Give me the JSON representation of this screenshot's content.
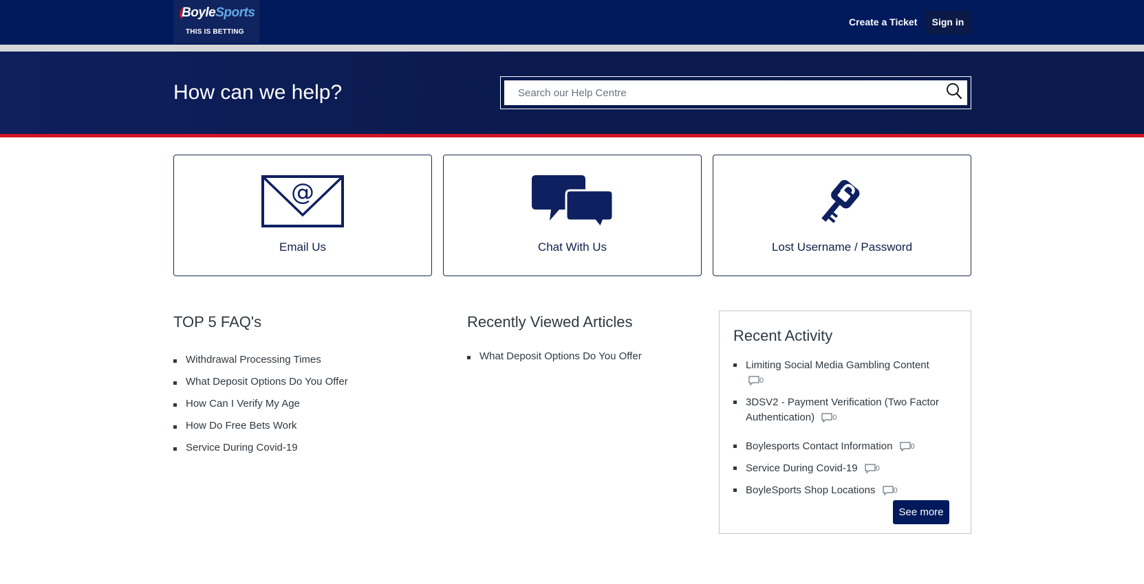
{
  "header": {
    "logo": {
      "word_main": "Boyle",
      "word_accent": "Sports",
      "tagline": "THIS IS BETTING"
    },
    "nav": {
      "create_ticket": "Create a Ticket",
      "sign_in": "Sign in"
    }
  },
  "hero": {
    "title": "How can we help?",
    "search": {
      "placeholder": "Search our Help Centre",
      "value": ""
    }
  },
  "cards": [
    {
      "label": "Email Us",
      "icon": "email-icon"
    },
    {
      "label": "Chat With Us",
      "icon": "chat-icon"
    },
    {
      "label": "Lost Username / Password",
      "icon": "key-lock-icon"
    }
  ],
  "top_faqs": {
    "title": "TOP 5 FAQ's",
    "items": [
      "Withdrawal Processing Times",
      "What Deposit Options Do You Offer",
      "How Can I Verify My Age",
      "How Do Free Bets Work",
      "Service During Covid-19"
    ]
  },
  "recently_viewed": {
    "title": "Recently Viewed Articles",
    "items": [
      "What Deposit Options Do You Offer"
    ]
  },
  "recent_activity": {
    "title": "Recent Activity",
    "items": [
      {
        "line1": "Limiting Social Media Gambling Content",
        "line2": "",
        "comments": "0"
      },
      {
        "line1": "3DSV2 - Payment Verification (Two Factor",
        "line2": "Authentication)",
        "comments": "0"
      },
      {
        "line1": "Boylesports Contact Information",
        "line2": "",
        "comments": "0"
      },
      {
        "line1": "Service During Covid-19",
        "line2": "",
        "comments": "0"
      },
      {
        "line1": "BoyleSports Shop Locations",
        "line2": "",
        "comments": "0"
      }
    ],
    "see_more": "See more"
  },
  "colors": {
    "navy": "#001a5c",
    "accent_red": "#d31525",
    "logo_blue": "#62a8e5"
  }
}
